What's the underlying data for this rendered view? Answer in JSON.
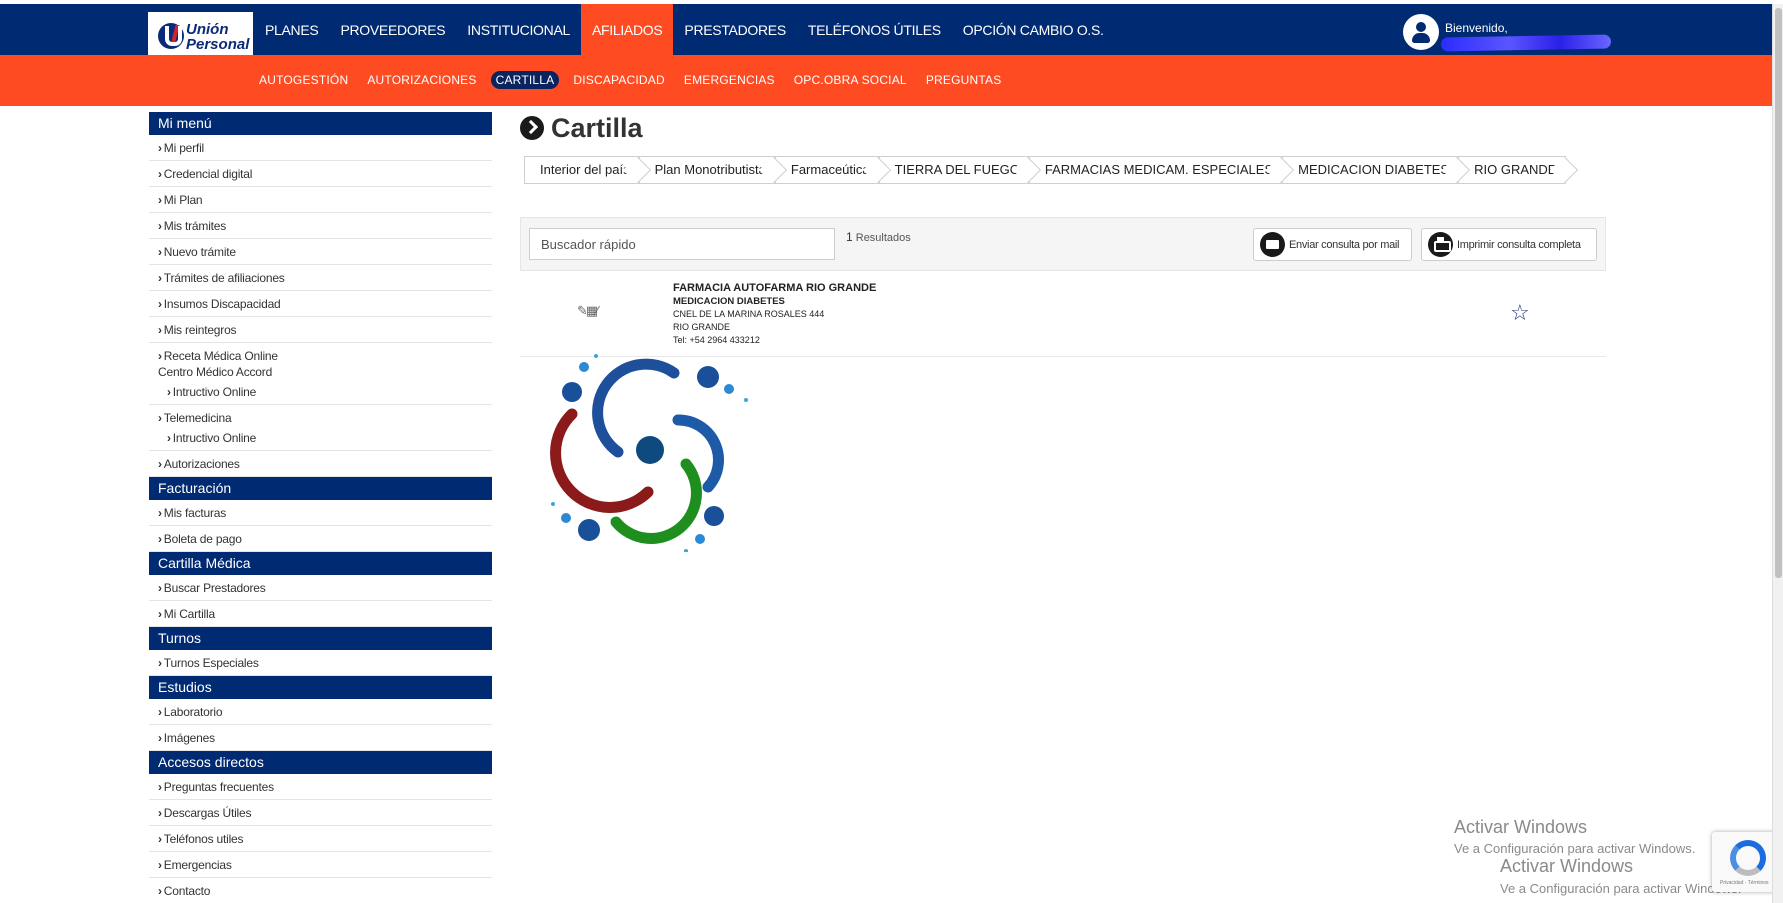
{
  "brand": {
    "name_line1": "Unión",
    "name_line2": "Personal"
  },
  "topnav": {
    "items": [
      {
        "label": "PLANES"
      },
      {
        "label": "PROVEEDORES"
      },
      {
        "label": "INSTITUCIONAL"
      },
      {
        "label": "AFILIADOS"
      },
      {
        "label": "PRESTADORES"
      },
      {
        "label": "TELÉFONOS ÚTILES"
      },
      {
        "label": "OPCIÓN CAMBIO O.S."
      }
    ],
    "active_index": 3
  },
  "user": {
    "welcome": "Bienvenido,"
  },
  "subnav": {
    "items": [
      {
        "label": "AUTOGESTIÓN"
      },
      {
        "label": "AUTORIZACIONES"
      },
      {
        "label": "CARTILLA"
      },
      {
        "label": "DISCAPACIDAD"
      },
      {
        "label": "EMERGENCIAS"
      },
      {
        "label": "OPC.OBRA SOCIAL"
      },
      {
        "label": "PREGUNTAS"
      }
    ],
    "active_index": 2
  },
  "sidebar": {
    "sections": [
      {
        "title": "Mi menú",
        "items": [
          {
            "label": "Mi perfil"
          },
          {
            "label": "Credencial digital"
          },
          {
            "label": "Mi Plan"
          },
          {
            "label": "Mis trámites"
          },
          {
            "label": "Nuevo trámite"
          },
          {
            "label": "Trámites de afiliaciones"
          },
          {
            "label": "Insumos Discapacidad"
          },
          {
            "label": "Mis reintegros"
          },
          {
            "label": "Receta Médica Online",
            "plain": "Centro Médico Accord",
            "sub": "Intructivo Online"
          },
          {
            "label": "Telemedicina",
            "sub": "Intructivo Online"
          },
          {
            "label": "Autorizaciones"
          }
        ]
      },
      {
        "title": "Facturación",
        "items": [
          {
            "label": "Mis facturas"
          },
          {
            "label": "Boleta de pago"
          }
        ]
      },
      {
        "title": "Cartilla Médica",
        "items": [
          {
            "label": "Buscar Prestadores"
          },
          {
            "label": "Mi Cartilla"
          }
        ]
      },
      {
        "title": "Turnos",
        "items": [
          {
            "label": "Turnos Especiales"
          }
        ]
      },
      {
        "title": "Estudios",
        "items": [
          {
            "label": "Laboratorio"
          },
          {
            "label": "Imágenes"
          }
        ]
      },
      {
        "title": "Accesos directos",
        "items": [
          {
            "label": "Preguntas frecuentes"
          },
          {
            "label": "Descargas Útiles"
          },
          {
            "label": "Teléfonos utiles"
          },
          {
            "label": "Emergencias"
          },
          {
            "label": "Contacto"
          }
        ]
      }
    ]
  },
  "main": {
    "title": "Cartilla",
    "breadcrumb": [
      "Interior del país",
      "Plan Monotributista",
      "Farmaceútica",
      "TIERRA DEL FUEGO",
      "FARMACIAS MEDICAM. ESPECIALES",
      "MEDICACION DIABETES",
      "RIO GRANDE"
    ],
    "search": {
      "placeholder": "Buscador rápido",
      "value": ""
    },
    "results_count": "1",
    "results_label": "Resultados",
    "buttons": {
      "mail": "Enviar consulta por mail",
      "print": "Imprimir consulta completa"
    },
    "result": {
      "name": "FARMACIA AUTOFARMA RIO GRANDE",
      "category": "MEDICACION DIABETES",
      "address": "CNEL DE LA MARINA ROSALES 444",
      "city": "RIO GRANDE",
      "phone": "Tel: +54 2964 433212"
    }
  },
  "watermark": {
    "title": "Activar Windows",
    "subtitle": "Ve a Configuración para activar Windows."
  },
  "recaptcha": {
    "text": "Privacidad - Términos"
  },
  "colors": {
    "navy": "#002a72",
    "orange": "#ff4b21",
    "spinner_blue": "#1d4f9a",
    "spinner_red": "#8b1a1a",
    "spinner_green": "#1e8f1e",
    "spinner_light": "#3aa6dd"
  }
}
